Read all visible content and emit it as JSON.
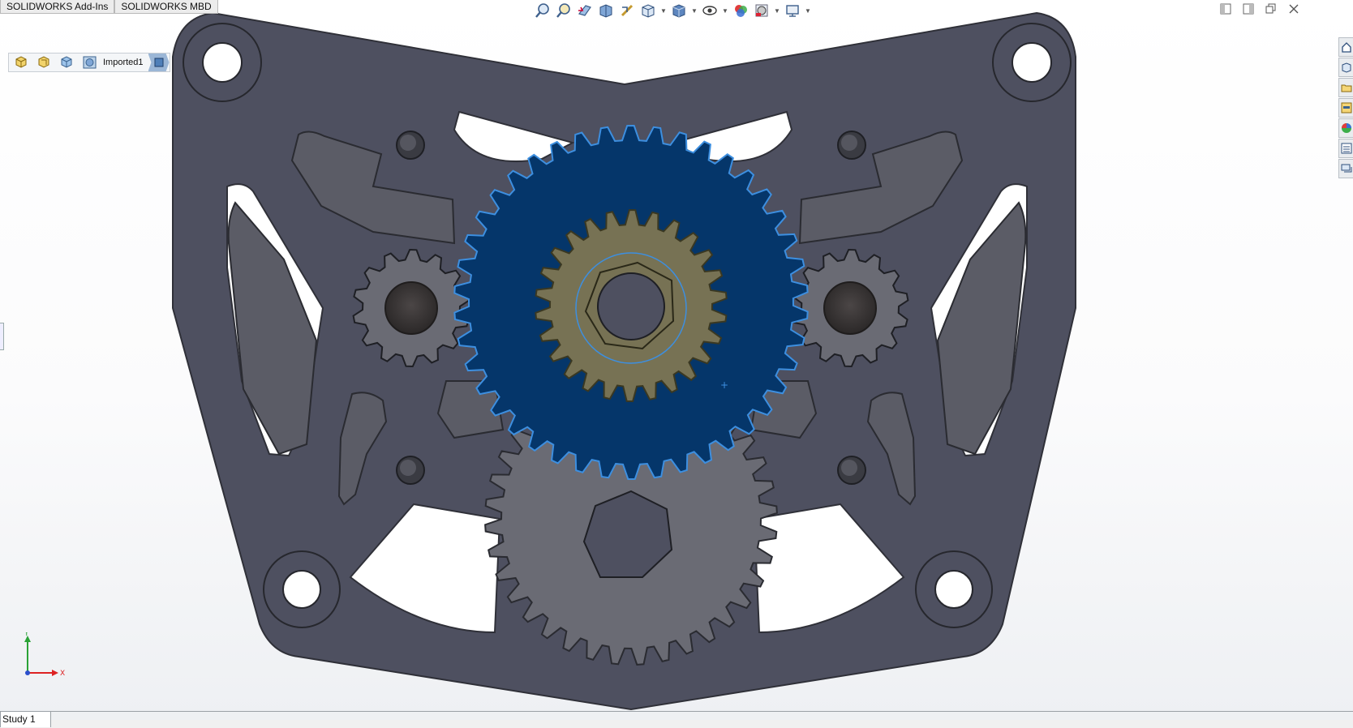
{
  "command_tabs": [
    "SOLIDWORKS Add-Ins",
    "SOLIDWORKS MBD"
  ],
  "hud_icons": [
    "zoom-to-fit-icon",
    "zoom-to-area-icon",
    "previous-view-icon",
    "section-view-icon",
    "dynamic-annotation-icon",
    "view-orientation-icon",
    "display-style-icon",
    "hide-show-items-icon",
    "edit-appearance-icon",
    "apply-scene-icon",
    "view-settings-icon"
  ],
  "breadcrumb": {
    "label": "Imported1"
  },
  "triad": {
    "y_label": "Y",
    "x_label": "X"
  },
  "sheet_tabs": [
    "Study 1"
  ],
  "colors": {
    "plate": "#4e5060",
    "plate_edge": "#2f3038",
    "selected_gear": "#05366a",
    "selected_outline": "#3d8fe0",
    "pinion_gear": "#777254",
    "small_gear": "#6a6b74",
    "background": "#ffffff"
  }
}
